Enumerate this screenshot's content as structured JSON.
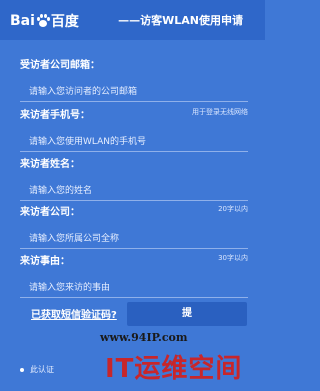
{
  "header": {
    "logo_left": "Bai",
    "logo_right": "百度",
    "title": "——访客WLAN使用申请"
  },
  "fields": [
    {
      "label": "受访者公司邮箱：",
      "hint": "",
      "placeholder": "请输入您访问者的公司邮箱"
    },
    {
      "label": "来访者手机号：",
      "hint": "用于登录无线网络",
      "placeholder": "请输入您使用WLAN的手机号"
    },
    {
      "label": "来访者姓名：",
      "hint": "",
      "placeholder": "请输入您的姓名"
    },
    {
      "label": "来访者公司：",
      "hint": "20字以内",
      "placeholder": "请输入您所属公司全称"
    },
    {
      "label": "来访事由：",
      "hint": "30字以内",
      "placeholder": "请输入您来访的事由"
    }
  ],
  "verify": {
    "link_label": "已获取短信验证码?",
    "submit_label": "提"
  },
  "footer": {
    "note": "此认证"
  },
  "watermark": {
    "url": "www.94IP.com",
    "text": "IT运维空间"
  }
}
